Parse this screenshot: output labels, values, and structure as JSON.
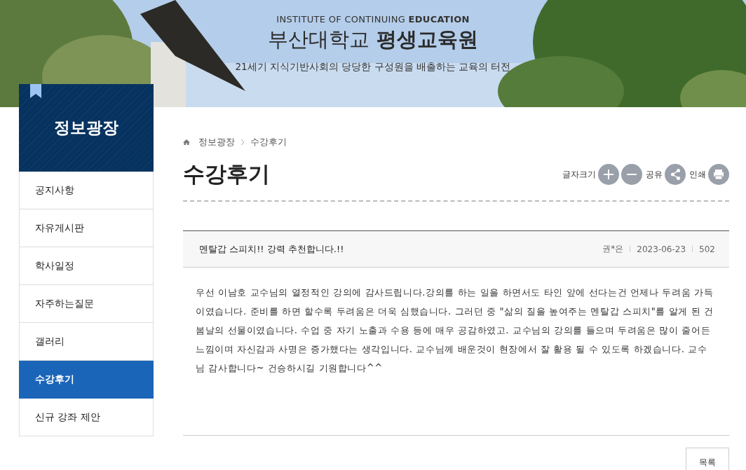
{
  "banner": {
    "kind": "picture",
    "subtitle_en_regular": "INSTITUTE OF CONTINUING ",
    "subtitle_en_bold": "EDUCATION",
    "title_regular": "부산대학교",
    "title_bold": "평생교육원",
    "slogan": "21세기 지식기반사회의 당당한 구성원을 배출하는 교육의 터전"
  },
  "sidebar": {
    "title": "정보광장",
    "items": [
      {
        "label": "공지사항",
        "selected": false
      },
      {
        "label": "자유게시판",
        "selected": false
      },
      {
        "label": "학사일정",
        "selected": false
      },
      {
        "label": "자주하는질문",
        "selected": false
      },
      {
        "label": "갤러리",
        "selected": false
      },
      {
        "label": "수강후기",
        "selected": true
      },
      {
        "label": "신규 강좌 제안",
        "selected": false
      }
    ]
  },
  "breadcrumb": [
    "정보광장",
    "수강후기"
  ],
  "page_title": "수강후기",
  "tools": {
    "font_size_label": "글자크기",
    "share_label": "공유",
    "print_label": "인쇄"
  },
  "post": {
    "title": "멘탈갑 스피치!! 강력 추천합니다.!!",
    "author": "권*은",
    "date": "2023-06-23",
    "views": "502",
    "body": "우선 이남호 교수님의 열정적인 강의에 감사드립니다.강의를 하는 일을 하면서도 타인 앞에 선다는건 언제나 두려움 가득이였습니다. 준비를 하면 할수록 두려움은 더욱 심했습니다. 그러던 중 \"삶의 질을 높여주는 멘탈갑 스피치\"를 알게 된 건 봄날의 선물이였습니다. 수업 중 자기 노출과 수용 등에 매우 공감하였고. 교수님의 강의를 들으며 두려움은 많이 줄어든 느낌이며 자신감과 사명은 증가했다는 생각입니다. 교수님께 배운것이 현장에서 잘 활용 될 수 있도록 하겠습니다. 교수님 감사합니다~ 건승하시길 기원합니다^^"
  },
  "list_button": "목록"
}
